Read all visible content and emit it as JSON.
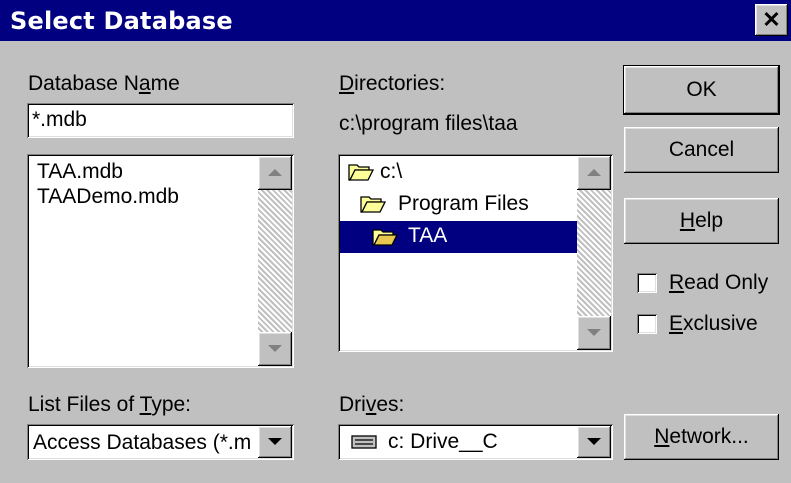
{
  "window": {
    "title": "Select Database",
    "close_glyph": "✕"
  },
  "database_name": {
    "label_pre": "Database N",
    "label_key": "a",
    "label_post": "me",
    "value": "*.mdb",
    "files": [
      "TAA.mdb",
      "TAADemo.mdb"
    ]
  },
  "directories": {
    "label_pre": "",
    "label_key": "D",
    "label_post": "irectories:",
    "path": "c:\\program files\\taa",
    "items": [
      {
        "label": "c:\\",
        "icon": "folder-open-icon"
      },
      {
        "label": "Program Files",
        "icon": "folder-open-icon"
      },
      {
        "label": "TAA",
        "icon": "folder-open-icon",
        "selected": true
      }
    ]
  },
  "file_type": {
    "label_pre": "List Files of ",
    "label_key": "T",
    "label_post": "ype:",
    "value": "Access Databases (*.m"
  },
  "drives": {
    "label_pre": "Dri",
    "label_key": "v",
    "label_post": "es:",
    "value": "c: Drive__C",
    "icon": "drive-icon"
  },
  "buttons": {
    "ok": "OK",
    "cancel": "Cancel",
    "help_key": "H",
    "help_rest": "elp",
    "network_key": "N",
    "network_rest": "etwork..."
  },
  "options": {
    "read_only_key": "R",
    "read_only_rest": "ead Only",
    "exclusive_key": "E",
    "exclusive_rest": "xclusive"
  },
  "colors": {
    "titlebar": "#000080",
    "selection": "#000080",
    "face": "#c0c0c0"
  }
}
